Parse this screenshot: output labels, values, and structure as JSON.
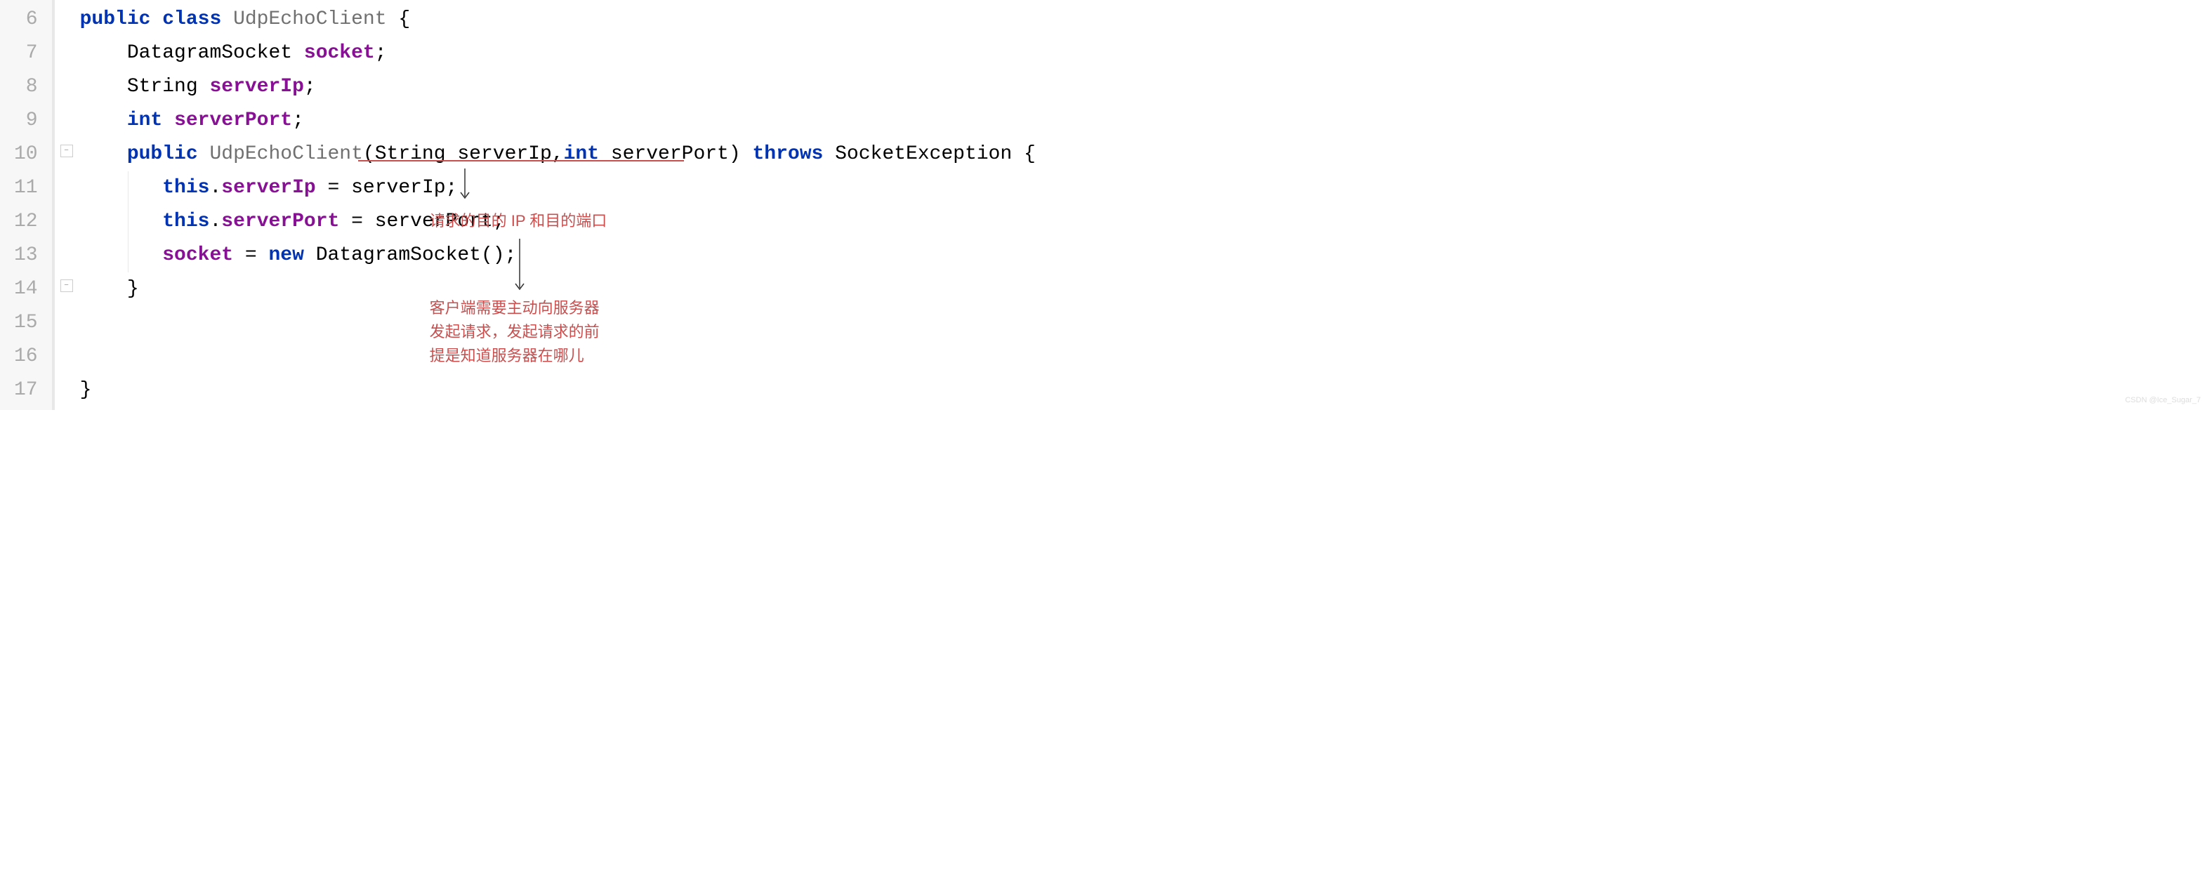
{
  "gutter": {
    "start": 6,
    "end": 17
  },
  "code": {
    "line6": {
      "kw1": "public",
      "kw2": "class",
      "cls": "UdpEchoClient",
      "brace": "{"
    },
    "line7": {
      "type": "DatagramSocket",
      "field": "socket",
      "semi": ";"
    },
    "line8": {
      "type": "String",
      "field": "serverIp",
      "semi": ";"
    },
    "line9": {
      "kw": "int",
      "field": "serverPort",
      "semi": ";"
    },
    "line10": {
      "kw1": "public",
      "cls": "UdpEchoClient",
      "paren1": "(",
      "ptype1": "String",
      "pname1": "serverIp",
      "comma": ",",
      "ptype2": "int",
      "pname2": "serverPort",
      "paren2": ")",
      "kw2": "throws",
      "exc": "SocketException",
      "brace": "{"
    },
    "line11": {
      "this": "this",
      "dot": ".",
      "field": "serverIp",
      "eq": " = ",
      "var": "serverIp",
      "semi": ";"
    },
    "line12": {
      "this": "this",
      "dot": ".",
      "field": "serverPort",
      "eq": " = ",
      "var": "serverPort",
      "semi": ";"
    },
    "line13": {
      "field": "socket",
      "eq": " = ",
      "kw": "new",
      "type": "DatagramSocket",
      "paren": "()",
      "semi": ";"
    },
    "line14": {
      "brace": "}"
    },
    "line17": {
      "brace": "}"
    }
  },
  "annotations": {
    "a1": "请求的目的 IP 和目的端口",
    "a2_l1": "客户端需要主动向服务器",
    "a2_l2": "发起请求，发起请求的前",
    "a2_l3": "提是知道服务器在哪儿"
  },
  "watermark": "CSDN @Ice_Sugar_7"
}
